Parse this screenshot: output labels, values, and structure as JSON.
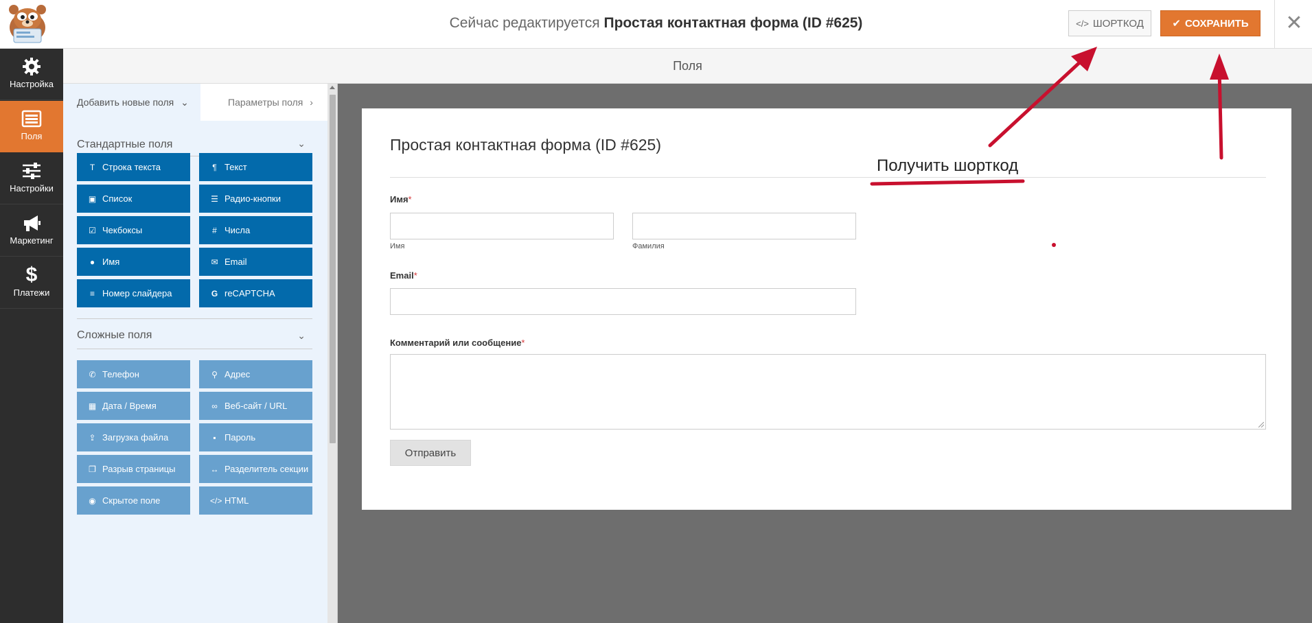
{
  "header": {
    "editing_prefix": "Сейчас редактируется",
    "form_name": "Простая контактная форма (ID #625)",
    "shortcode_label": "ШОРТКОД",
    "save_label": "СОХРАНИТЬ",
    "close_icon": "close-icon"
  },
  "nav": {
    "items": [
      {
        "label": "Настройка",
        "icon": "gear-icon"
      },
      {
        "label": "Поля",
        "icon": "fields-icon",
        "active": true
      },
      {
        "label": "Настройки",
        "icon": "sliders-icon"
      },
      {
        "label": "Маркетинг",
        "icon": "megaphone-icon"
      },
      {
        "label": "Платежи",
        "icon": "dollar-icon"
      }
    ]
  },
  "section": {
    "title": "Поля"
  },
  "panel": {
    "tabs": {
      "add": "Добавить новые поля",
      "options": "Параметры поля"
    },
    "standard": {
      "title": "Стандартные поля",
      "fields": [
        "Строка текста",
        "Текст",
        "Список",
        "Радио-кнопки",
        "Чекбоксы",
        "Числа",
        "Имя",
        "Email",
        "Номер слайдера",
        "reCAPTCHA"
      ]
    },
    "fancy": {
      "title": "Сложные поля",
      "fields": [
        "Телефон",
        "Адрес",
        "Дата / Время",
        "Веб-сайт / URL",
        "Загрузка файла",
        "Пароль",
        "Разрыв страницы",
        "Разделитель секции",
        "Скрытое поле",
        "HTML"
      ]
    }
  },
  "form": {
    "title": "Простая контактная форма (ID #625)",
    "name_label": "Имя",
    "first_sub": "Имя",
    "last_sub": "Фамилия",
    "email_label": "Email",
    "message_label": "Комментарий или сообщение",
    "required_mark": "*",
    "submit_label": "Отправить"
  },
  "annotation": {
    "text": "Получить шорткод",
    "color": "#c8102e"
  },
  "colors": {
    "accent": "#e27730",
    "field_button": "#036aab",
    "fancy_button": "#68a1ce",
    "nav_bg": "#2d2d2d"
  }
}
